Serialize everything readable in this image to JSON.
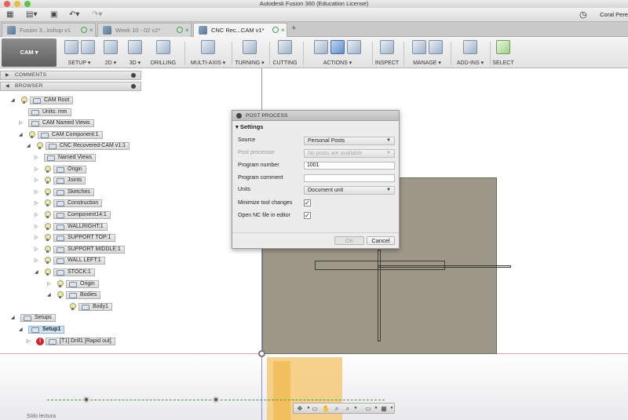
{
  "window": {
    "title": "Autodesk Fusion 360 (Education License)",
    "user": "Coral Pere"
  },
  "doc_tabs": [
    {
      "label": "Fusion 3...kshop v1",
      "active": false
    },
    {
      "label": "Week 10 - 02 v2*",
      "active": false
    },
    {
      "label": "CNC Rec...CAM v1*",
      "active": true
    }
  ],
  "ribbon": {
    "workspace": "CAM ▾",
    "groups": [
      "SETUP ▾",
      "2D ▾",
      "3D ▾",
      "DRILLING",
      "MULTI-AXIS ▾",
      "TURNING ▾",
      "CUTTING",
      "ACTIONS ▾",
      "INSPECT",
      "MANAGE ▾",
      "ADD-INS ▾",
      "SELECT"
    ]
  },
  "panels": {
    "comments": "COMMENTS",
    "browser": "BROWSER"
  },
  "tree": [
    {
      "label": "CAM Root",
      "indent": 0,
      "bulb": true
    },
    {
      "label": "Units: mm",
      "indent": 1,
      "bulb": false
    },
    {
      "label": "CAM Named Views",
      "indent": 1,
      "bulb": false
    },
    {
      "label": "CAM Component:1",
      "indent": 1,
      "bulb": true
    },
    {
      "label": "CNC Recovered-CAM v1:1",
      "indent": 2,
      "bulb": true
    },
    {
      "label": "Named Views",
      "indent": 3,
      "bulb": false
    },
    {
      "label": "Origin",
      "indent": 3,
      "bulb": true
    },
    {
      "label": "Joints",
      "indent": 3,
      "bulb": true
    },
    {
      "label": "Sketches",
      "indent": 3,
      "bulb": true
    },
    {
      "label": "Construction",
      "indent": 3,
      "bulb": true
    },
    {
      "label": "Component14:1",
      "indent": 3,
      "bulb": true
    },
    {
      "label": "WALLRIGHT:1",
      "indent": 3,
      "bulb": true
    },
    {
      "label": "SUPPORT TOP:1",
      "indent": 3,
      "bulb": true
    },
    {
      "label": "SUPPORT MIDDLE:1",
      "indent": 3,
      "bulb": true
    },
    {
      "label": "WALL LEFT:1",
      "indent": 3,
      "bulb": true
    },
    {
      "label": "STOCK:1",
      "indent": 3,
      "bulb": true
    },
    {
      "label": "Origin",
      "indent": 4,
      "bulb": true
    },
    {
      "label": "Bodies",
      "indent": 4,
      "bulb": true
    },
    {
      "label": "Body1",
      "indent": 5,
      "bulb": true
    },
    {
      "label": "Setups",
      "indent": 0,
      "bulb": false
    },
    {
      "label": "Setup1",
      "indent": 1,
      "bulb": false,
      "selected": true
    },
    {
      "label": "[T1] Drill1 [Rapid out]",
      "indent": 2,
      "bulb": false,
      "error": true
    }
  ],
  "dialog": {
    "title": "POST PROCESS",
    "section": "Settings",
    "fields": {
      "source_label": "Source",
      "source_value": "Personal Posts",
      "post_label": "Post processor",
      "post_value": "No posts are available",
      "program_number_label": "Program number",
      "program_number_value": "1001",
      "program_comment_label": "Program comment",
      "program_comment_value": "",
      "units_label": "Units",
      "units_value": "Document unit",
      "minimize_label": "Minimize tool changes",
      "minimize_checked": "✓",
      "open_nc_label": "Open NC file in editor",
      "open_nc_checked": "✓"
    },
    "ok": "OK",
    "cancel": "Cancel"
  },
  "status": {
    "read_only": "Sólo lectura"
  },
  "colors": {
    "stock": "#9e9889",
    "accent": "#6b74d8",
    "setup_highlight": "#cfe1f7"
  }
}
